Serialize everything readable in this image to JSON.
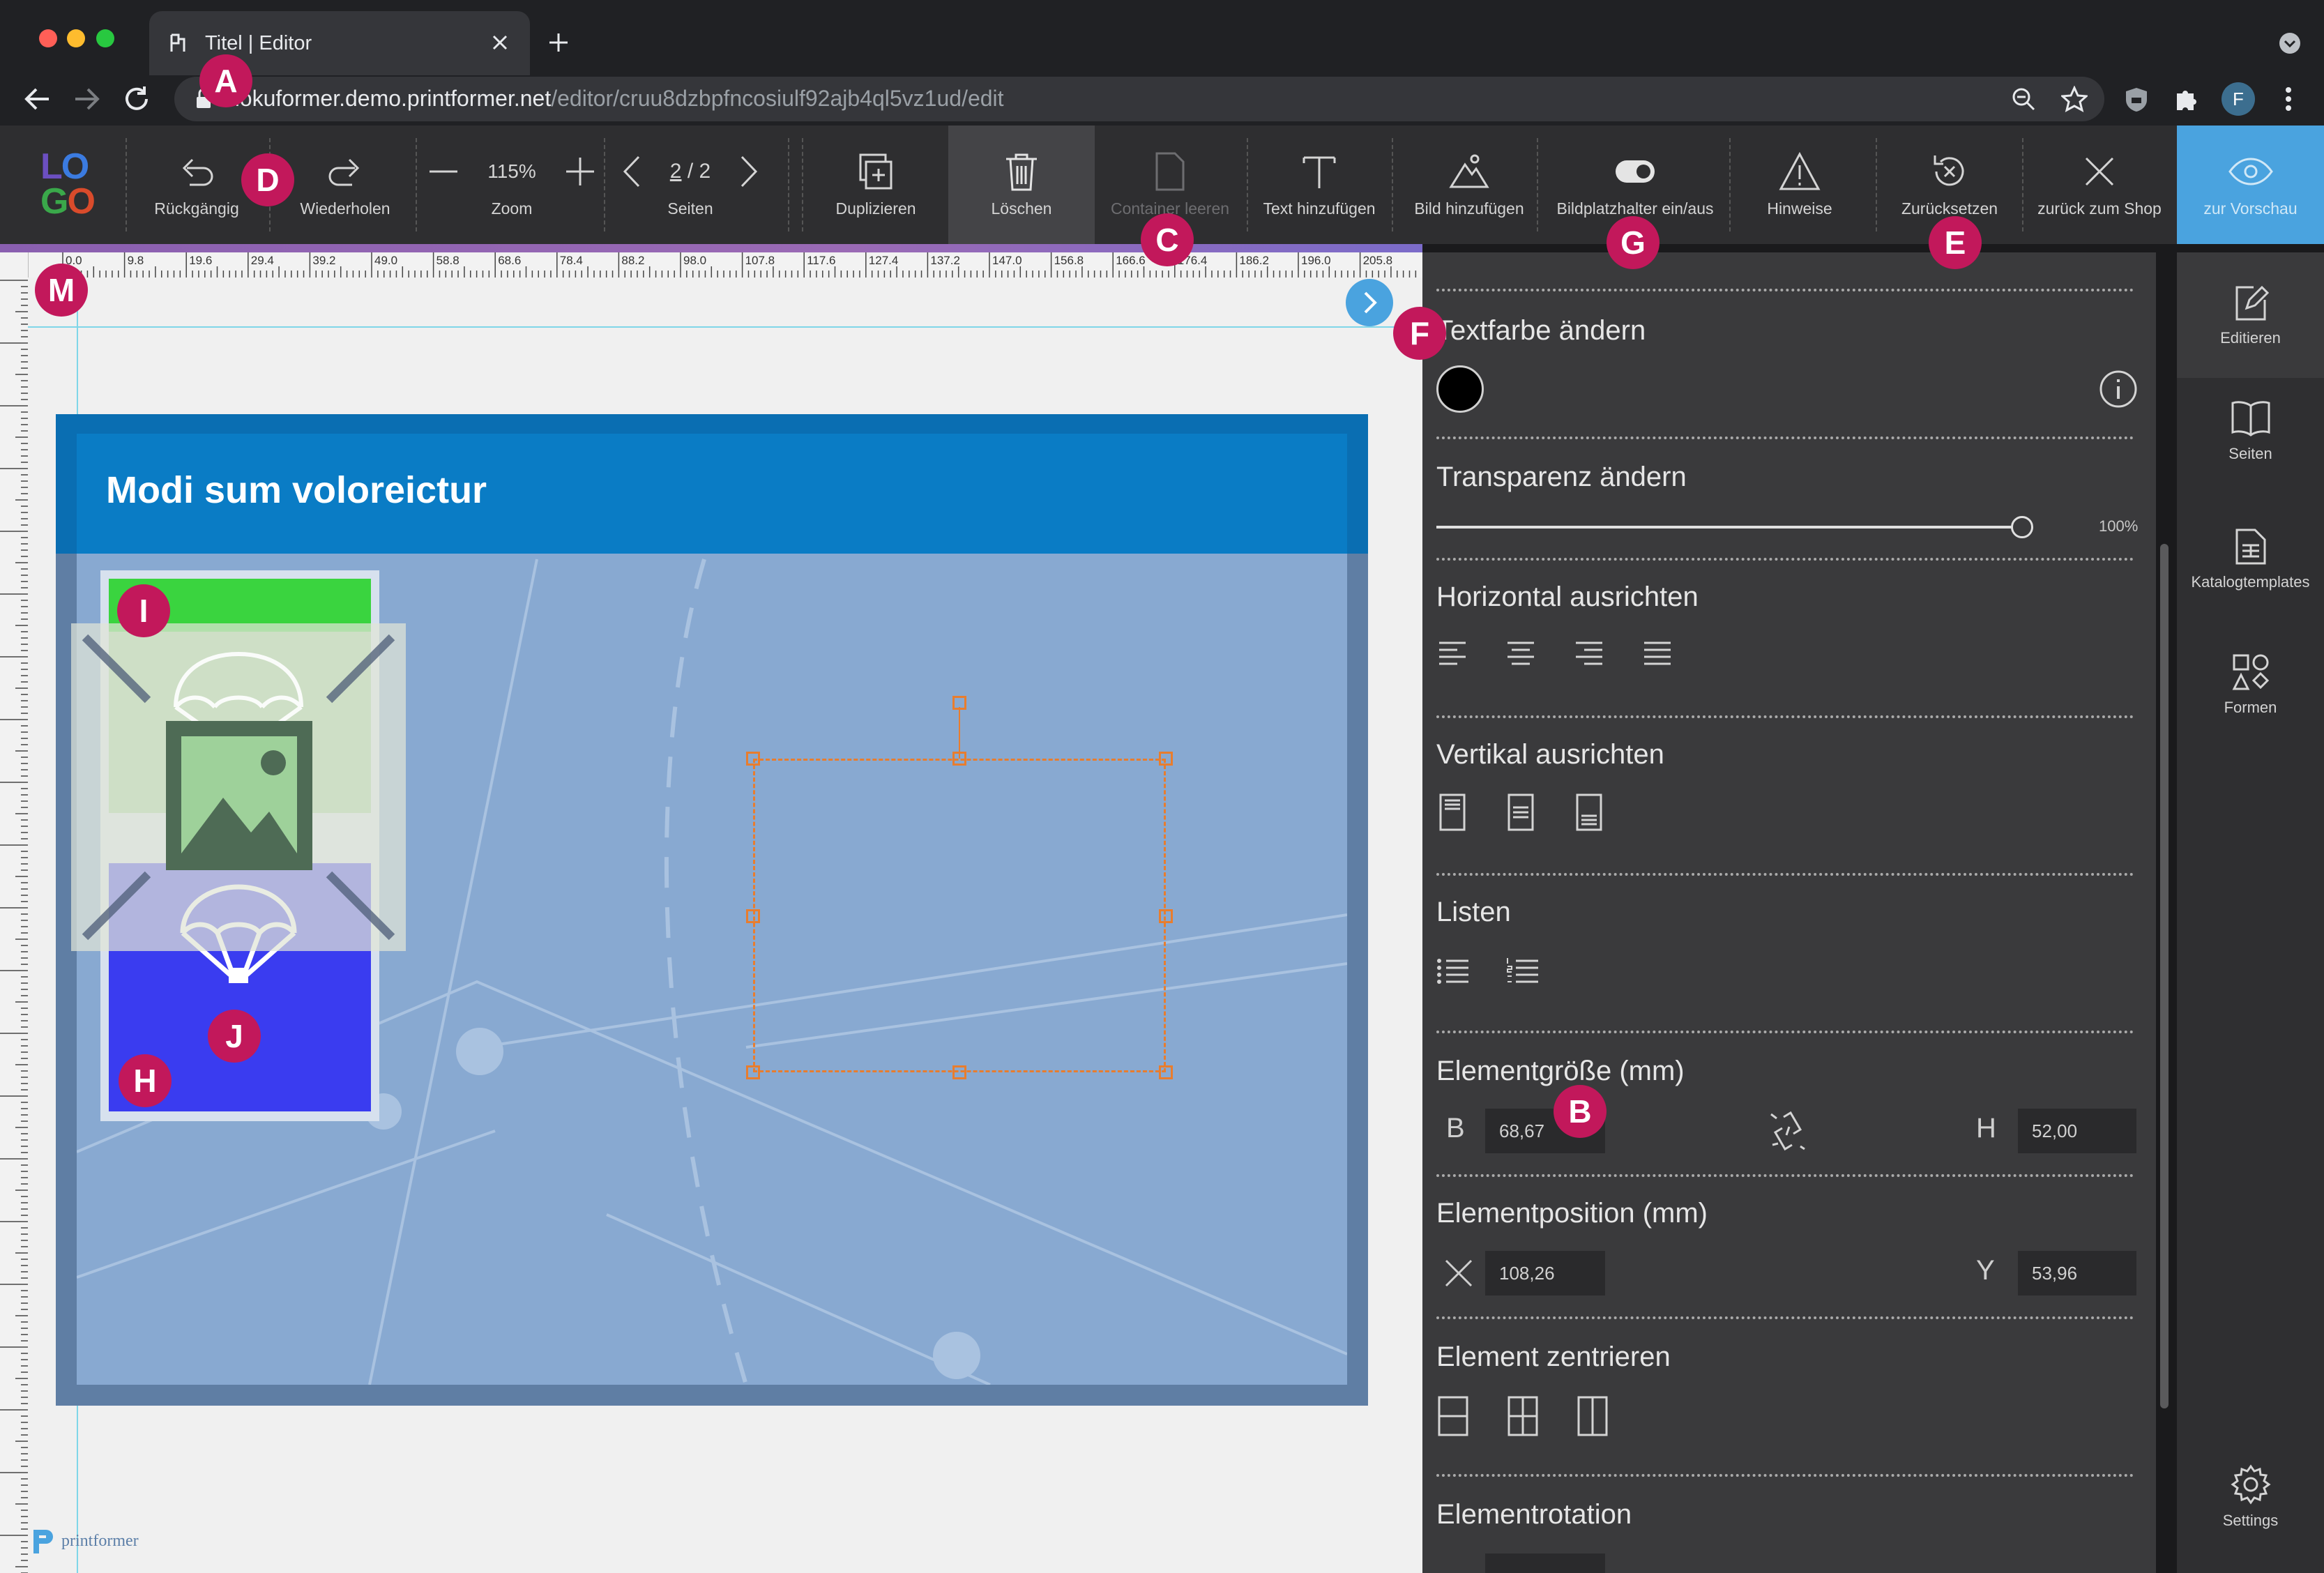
{
  "browser": {
    "tab_title": "Titel | Editor",
    "url_host": "dokuformer.demo.printformer.net",
    "url_path": "/editor/cruu8dzbpfncosiulf92ajb4ql5vz1ud/edit",
    "profile_initial": "F"
  },
  "toolbar": {
    "logo_line1": "LO",
    "logo_line2": "GO",
    "undo": "Rückgängig",
    "redo": "Wiederholen",
    "zoom_label": "Zoom",
    "zoom_value": "115%",
    "pages_label": "Seiten",
    "page_current": "2",
    "page_total": "/ 2",
    "duplicate": "Duplizieren",
    "delete": "Löschen",
    "empty_container": "Container leeren",
    "add_text": "Text hinzufügen",
    "add_image": "Bild hinzufügen",
    "toggle_placeholder": "Bildplatzhalter ein/aus",
    "hints": "Hinweise",
    "reset": "Zurücksetzen",
    "back_to_shop": "zurück zum Shop",
    "preview": "zur Vorschau"
  },
  "ruler": {
    "ticks": [
      "0.0",
      "9.8",
      "19.6",
      "29.4",
      "39.2",
      "49.0",
      "58.8",
      "68.6",
      "78.4",
      "88.2",
      "98.0",
      "107.8",
      "117.6",
      "127.4",
      "137.2",
      "147.0",
      "156.8",
      "166.6",
      "176.4",
      "186.2",
      "196.0",
      "205.8"
    ]
  },
  "canvas": {
    "heading": "Modi sum voloreictur"
  },
  "panel": {
    "text_color_title": "Textfarbe ändern",
    "text_color_value": "#000000",
    "transparency_title": "Transparenz ändern",
    "transparency_percent": 100,
    "transparency_value": "100%",
    "h_align_title": "Horizontal ausrichten",
    "v_align_title": "Vertikal ausrichten",
    "lists_title": "Listen",
    "size_title": "Elementgröße (mm)",
    "width_label": "B",
    "width_value": "68,67",
    "height_label": "H",
    "height_value": "52,00",
    "position_title": "Elementposition (mm)",
    "x_value": "108,26",
    "y_label": "Y",
    "y_value": "53,96",
    "center_title": "Element zentrieren",
    "rotation_title": "Elementrotation"
  },
  "sidebar": {
    "edit": "Editieren",
    "pages": "Seiten",
    "catalog": "Katalogtemplates",
    "shapes": "Formen",
    "settings": "Settings"
  },
  "branding": "printformer",
  "callouts": {
    "a": "A",
    "b": "B",
    "c": "C",
    "d": "D",
    "e": "E",
    "f": "F",
    "g": "G",
    "h": "H",
    "i": "I",
    "j": "J",
    "m": "M"
  },
  "colors": {
    "accent_blue": "#4aa3df",
    "header_blue": "#0a7cc5",
    "canvas_blue": "#88a9d1",
    "selection_orange": "#e87d2e",
    "callout_red": "#c2185b"
  }
}
